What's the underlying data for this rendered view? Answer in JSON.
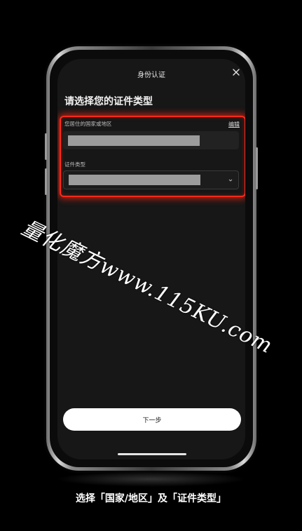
{
  "header": {
    "title": "身份认证"
  },
  "page": {
    "heading": "请选择您的证件类型"
  },
  "form": {
    "country_label": "您居住的国家或地区",
    "edit_label": "编辑",
    "doctype_label": "证件类型"
  },
  "footer": {
    "next_label": "下一步"
  },
  "watermark": {
    "text": "量化魔方www.115KU.com"
  },
  "caption": {
    "text": "选择「国家/地区」及「证件类型」"
  },
  "colors": {
    "highlight": "#ff2a1a",
    "screen_bg": "#171717",
    "button_bg": "#ffffff"
  },
  "icons": {
    "close": "close-icon",
    "dropdown": "chevron-down-icon"
  }
}
